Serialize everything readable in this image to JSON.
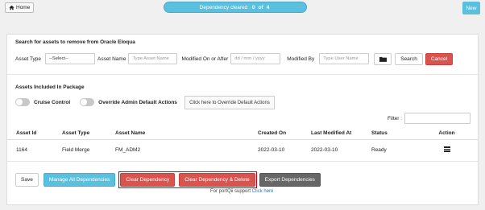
{
  "topbar": {
    "home_label": "Home",
    "progress_prefix": "Dependency cleared :",
    "progress_done": "0",
    "progress_of": "of",
    "progress_total": "4",
    "new_label": "New"
  },
  "search": {
    "title": "Search for assets to remove from Oracle Eloqua",
    "asset_type_label": "Asset Type",
    "asset_type_value": "--Select--",
    "asset_name_label": "Asset Name",
    "asset_name_placeholder": "Type Asset Name",
    "modified_on_label": "Modified On or After",
    "modified_on_placeholder": "dd / mm / yyyy",
    "modified_by_label": "Modified By",
    "modified_by_placeholder": "Type User Name",
    "search_label": "Search",
    "cancel_label": "Cancel"
  },
  "package": {
    "title": "Assets Included In Package",
    "cruise_label": "Cruise Control",
    "override_label": "Override Admin Default Actions",
    "override_button": "Click here to Override Default Actions",
    "filter_label": "Filter :"
  },
  "table": {
    "headers": [
      "Asset Id",
      "Asset Type",
      "Asset Name",
      "Created On",
      "Last Modified At",
      "Status",
      "Action"
    ],
    "rows": [
      [
        "1164",
        "Field Merge",
        "FM_ADM2",
        "2022-03-10",
        "2022-03-10",
        "Ready"
      ]
    ]
  },
  "actions": {
    "save": "Save",
    "manage": "Manage All Dependencies",
    "clear": "Clear Dependency",
    "clear_delete": "Clear Dependency & Delete",
    "export": "Export Dependencies"
  },
  "footer": {
    "support_text": "For portQii support",
    "support_link": "Click here"
  },
  "colors": {
    "info": "#5bc0de",
    "danger": "#d9534f",
    "dark": "#666666",
    "highlight_box": "#d0021b"
  }
}
